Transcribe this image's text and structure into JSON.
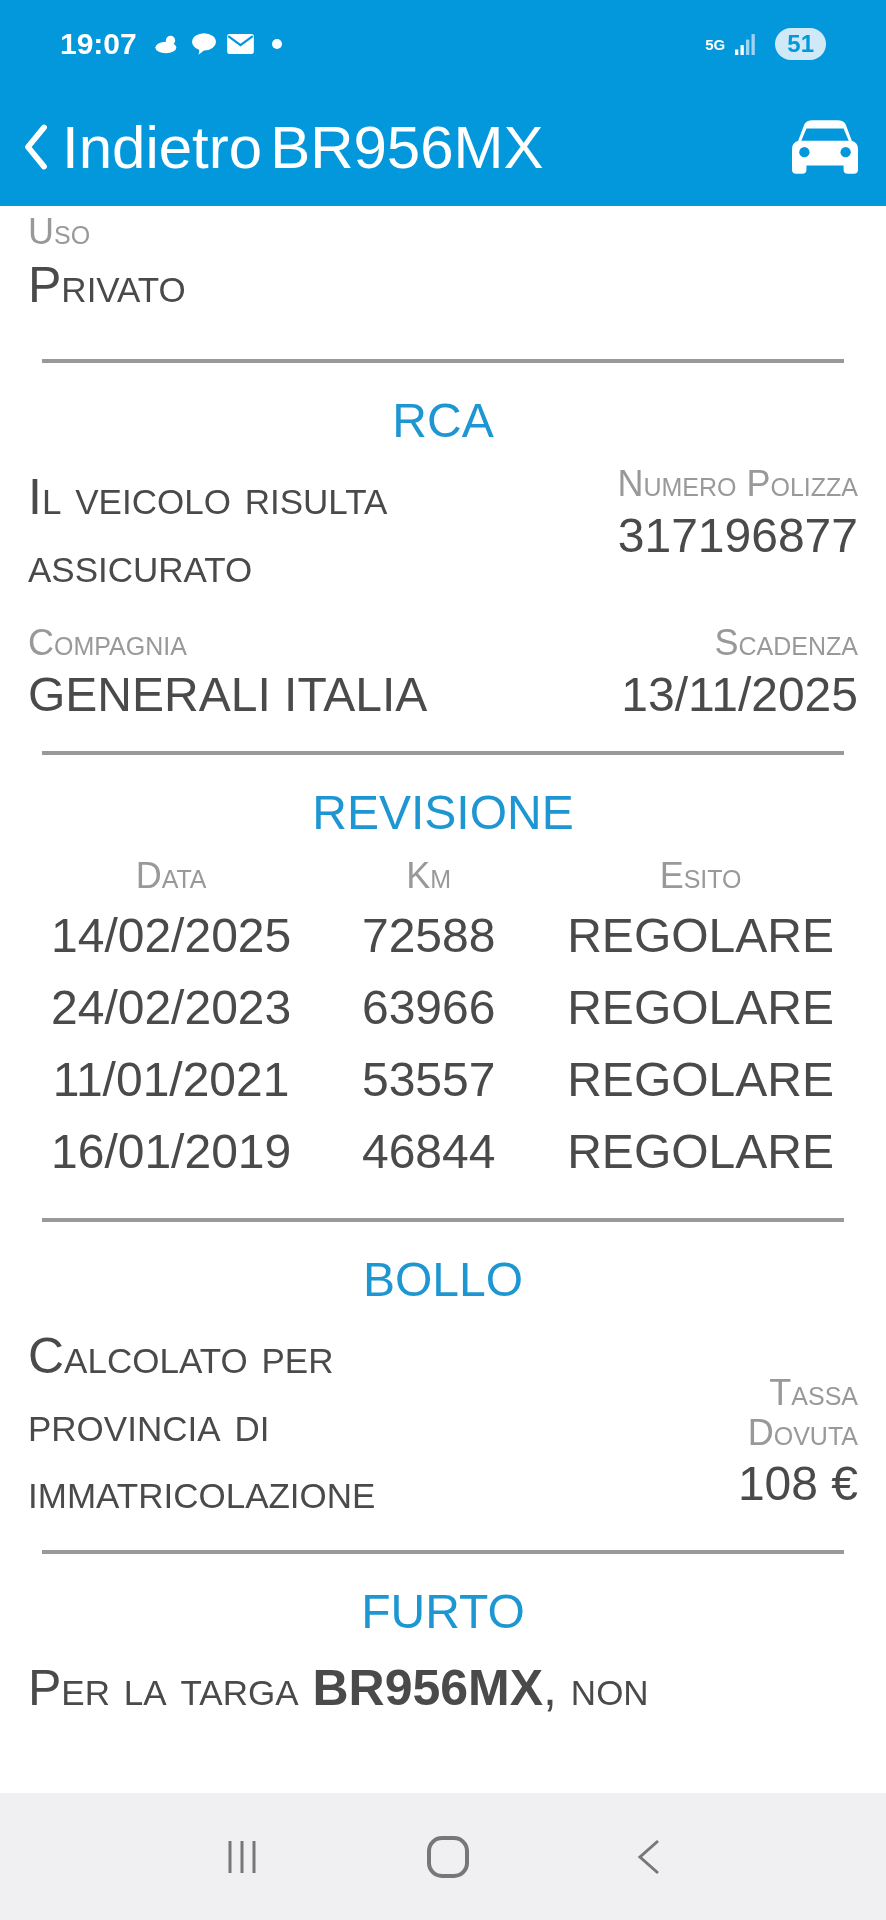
{
  "status_bar": {
    "time": "19:07",
    "network": "5G",
    "battery": "51"
  },
  "header": {
    "back": "Indietro",
    "title": "BR956MX"
  },
  "uso": {
    "label": "Uso",
    "value": "Privato"
  },
  "rca": {
    "title": "RCA",
    "status": "Il veicolo risulta assicurato",
    "policy_label": "Numero Polizza",
    "policy_number": "317196877",
    "company_label": "Compagnia",
    "company": "GENERALI ITALIA",
    "expiry_label": "Scadenza",
    "expiry": "13/11/2025"
  },
  "revisione": {
    "title": "REVISIONE",
    "columns": [
      "Data",
      "Km",
      "Esito"
    ],
    "rows": [
      [
        "14/02/2025",
        "72588",
        "REGOLARE"
      ],
      [
        "24/02/2023",
        "63966",
        "REGOLARE"
      ],
      [
        "11/01/2021",
        "53557",
        "REGOLARE"
      ],
      [
        "16/01/2019",
        "46844",
        "REGOLARE"
      ]
    ]
  },
  "bollo": {
    "title": "BOLLO",
    "note": "Calcolato per provincia di immatricolazione",
    "tax_label": "Tassa Dovuta",
    "tax": "108 €"
  },
  "furto": {
    "title": "FURTO",
    "text": "Per la targa **BR956MX**, non"
  }
}
